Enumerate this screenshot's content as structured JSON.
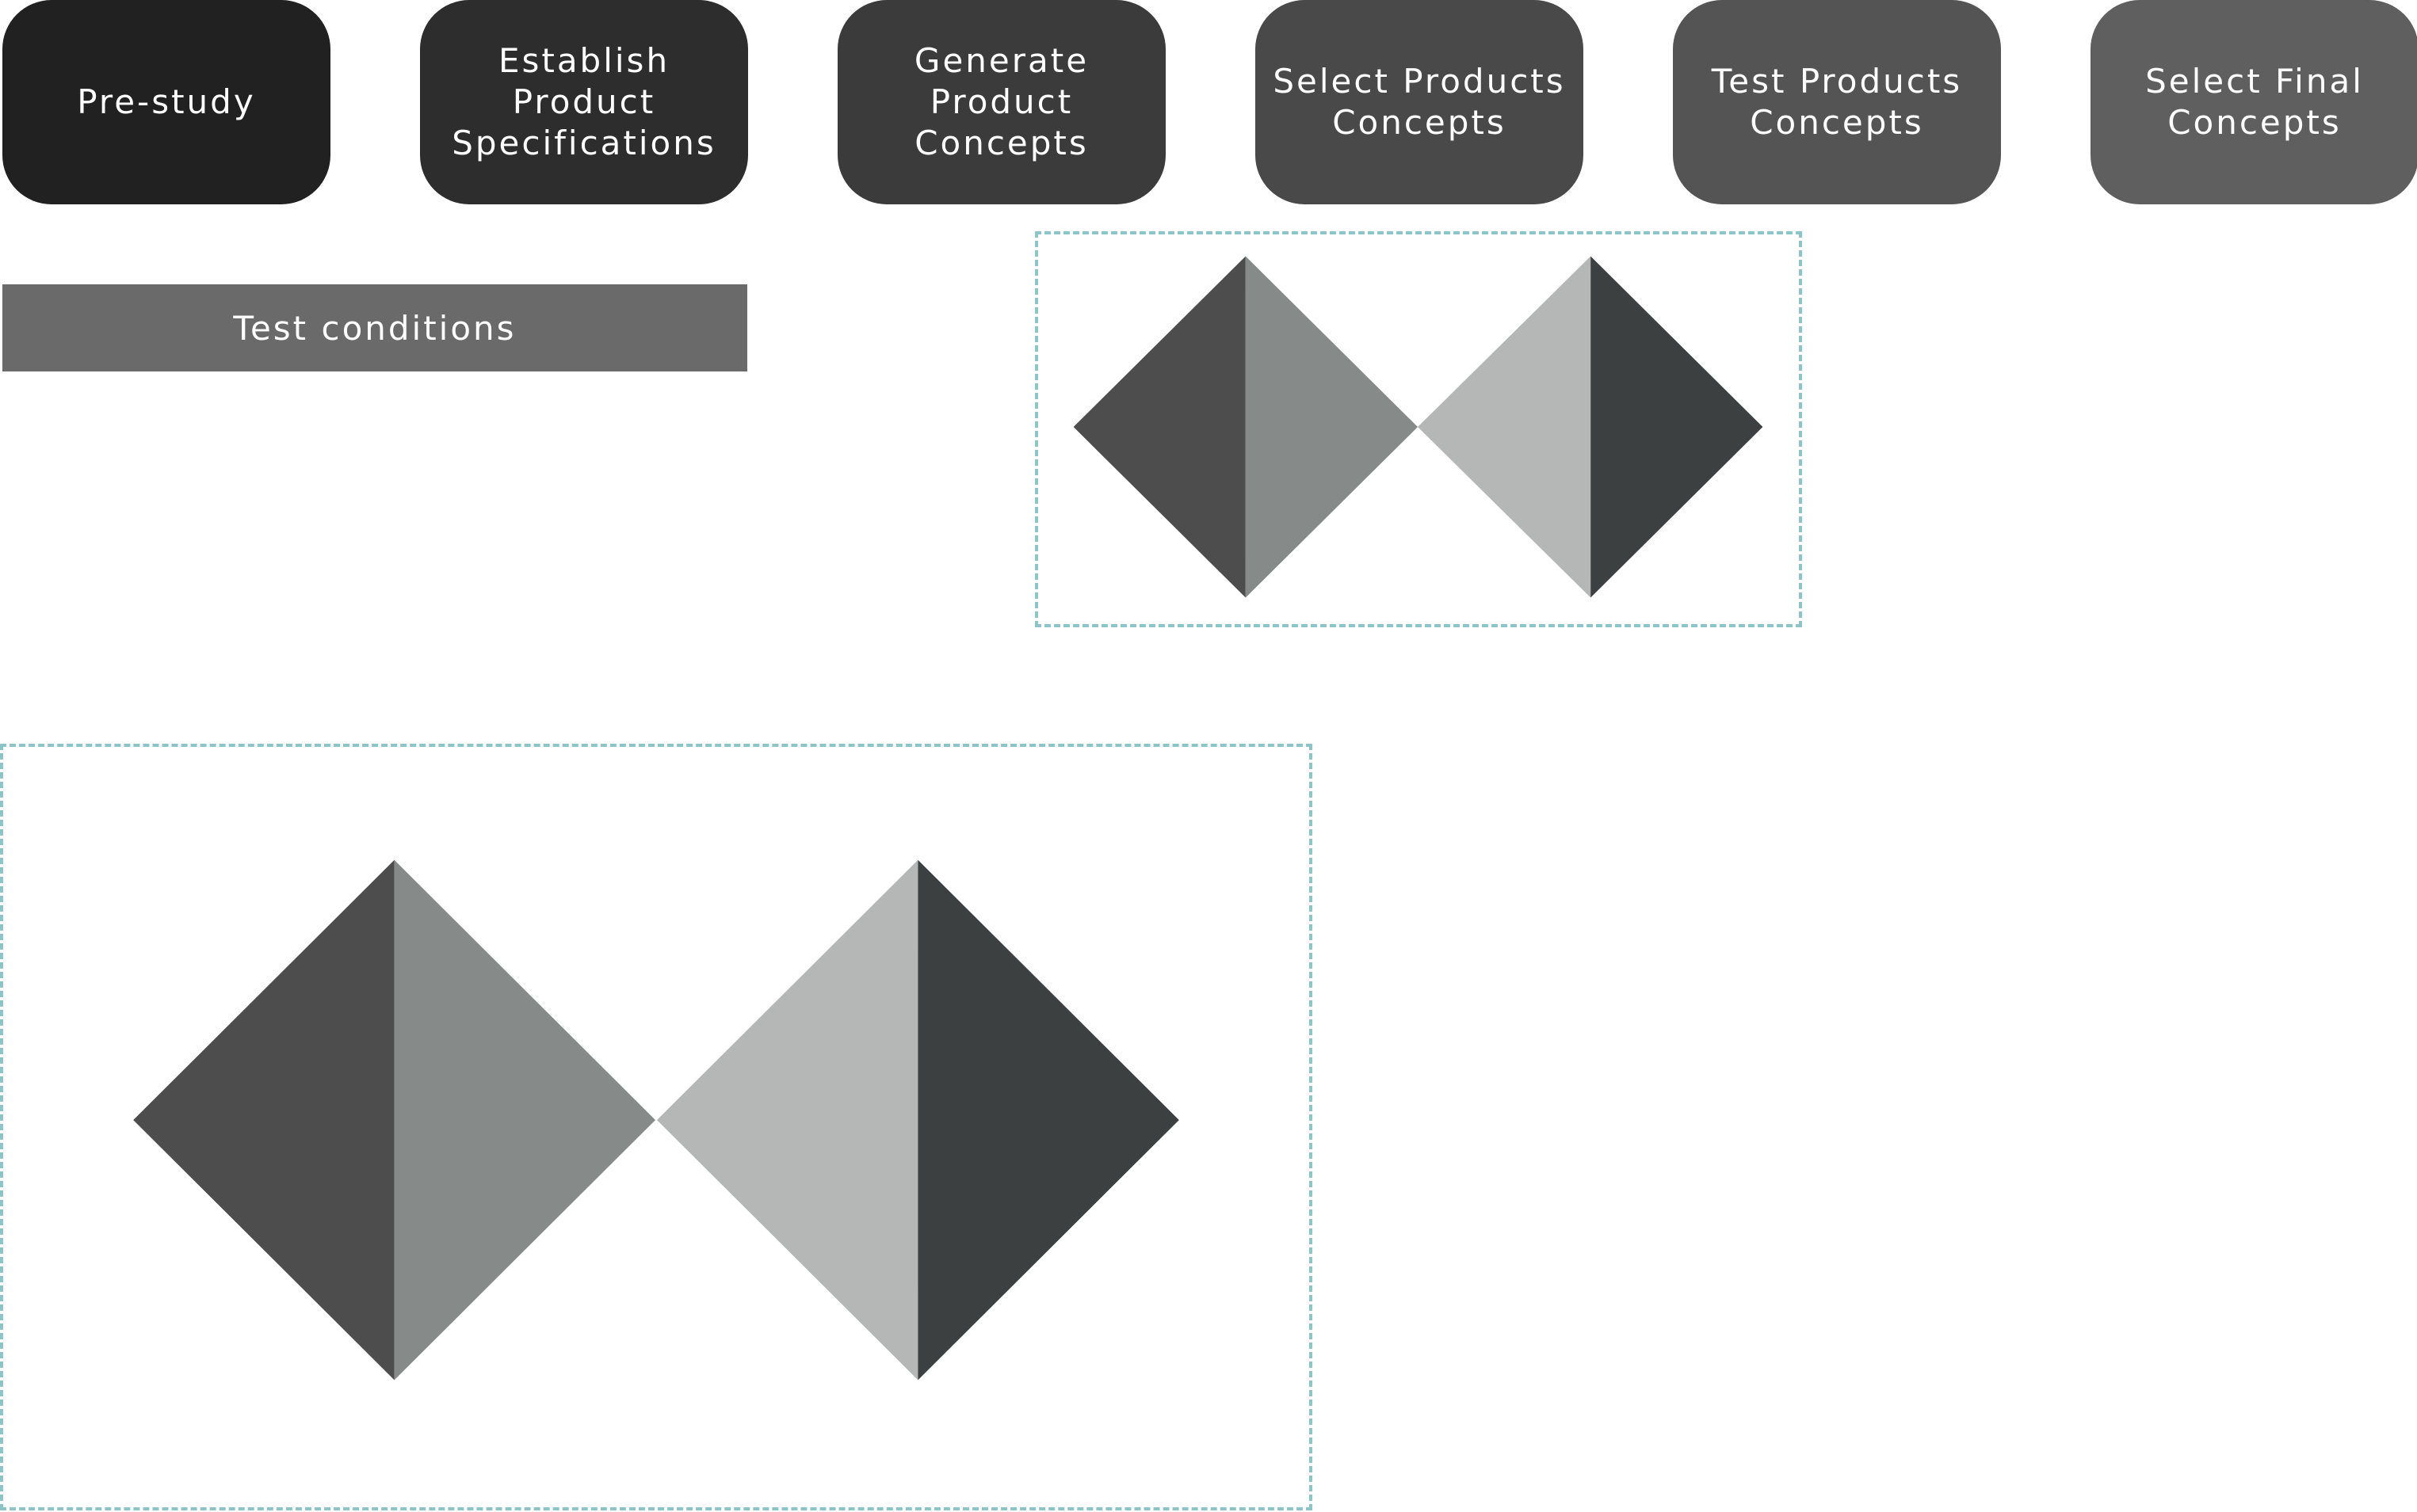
{
  "process_steps": [
    {
      "label": "Pre-study",
      "color": "#212121"
    },
    {
      "label": "Establish Product\nSpecifications",
      "color": "#2d2d2d"
    },
    {
      "label": "Generate Product\nConcepts",
      "color": "#3b3b3b"
    },
    {
      "label": "Select Products\nConcepts",
      "color": "#494949"
    },
    {
      "label": "Test Products\nConcepts",
      "color": "#545454"
    },
    {
      "label": "Select Final\nConcepts",
      "color": "#5f5f5f"
    }
  ],
  "test_conditions": {
    "label": "Test conditions",
    "color": "#6a6a6a"
  },
  "double_diamond": {
    "frame_color": "#8cc4c8",
    "diamond_1": {
      "left_half_color": "#4d4d4d",
      "right_half_color": "#868a89"
    },
    "diamond_2": {
      "left_half_color": "#b4b7b5",
      "right_half_color": "#3d4040"
    }
  }
}
